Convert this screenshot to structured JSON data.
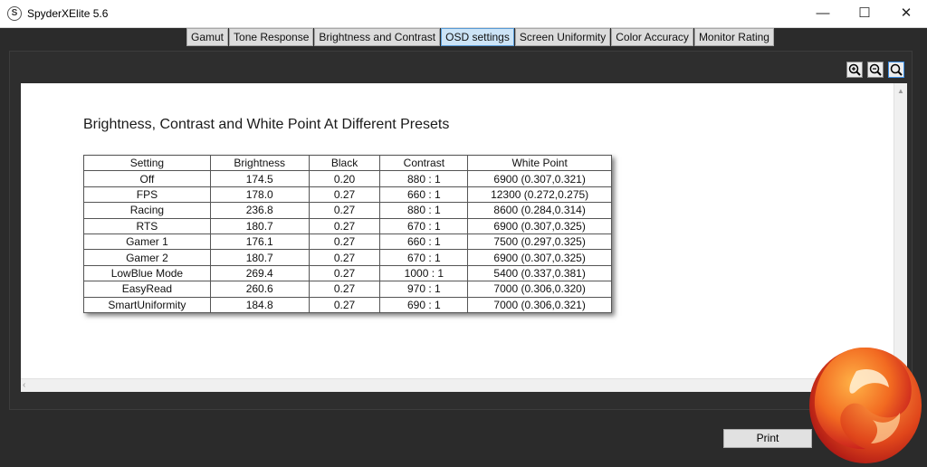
{
  "window": {
    "title": "SpyderXElite 5.6",
    "app_icon": "S"
  },
  "window_controls": {
    "minimize": "—",
    "maximize": "☐",
    "close": "✕"
  },
  "tabs": [
    "Gamut",
    "Tone Response",
    "Brightness and Contrast",
    "OSD settings",
    "Screen Uniformity",
    "Color Accuracy",
    "Monitor Rating"
  ],
  "active_tab": "OSD settings",
  "report": {
    "title": "Brightness, Contrast and White Point At Different Presets",
    "table": {
      "headers": [
        "Setting",
        "Brightness",
        "Black",
        "Contrast",
        "White Point"
      ],
      "rows": [
        [
          "Off",
          "174.5",
          "0.20",
          "880 : 1",
          "6900 (0.307,0.321)"
        ],
        [
          "FPS",
          "178.0",
          "0.27",
          "660 : 1",
          "12300 (0.272,0.275)"
        ],
        [
          "Racing",
          "236.8",
          "0.27",
          "880 : 1",
          "8600 (0.284,0.314)"
        ],
        [
          "RTS",
          "180.7",
          "0.27",
          "670 : 1",
          "6900 (0.307,0.325)"
        ],
        [
          "Gamer 1",
          "176.1",
          "0.27",
          "660 : 1",
          "7500 (0.297,0.325)"
        ],
        [
          "Gamer 2",
          "180.7",
          "0.27",
          "670 : 1",
          "6900 (0.307,0.325)"
        ],
        [
          "LowBlue Mode",
          "269.4",
          "0.27",
          "1000 : 1",
          "5400 (0.337,0.381)"
        ],
        [
          "EasyRead",
          "260.6",
          "0.27",
          "970 : 1",
          "7000 (0.306,0.320)"
        ],
        [
          "SmartUniformity",
          "184.8",
          "0.27",
          "690 : 1",
          "7000 (0.306,0.321)"
        ]
      ]
    }
  },
  "toolbar": {
    "zoom_in_icon": "zoom-in",
    "zoom_out_icon": "zoom-out",
    "zoom_fit_icon": "magnifier"
  },
  "print_label": "Print",
  "colors": {
    "active_tab_bg": "#cce4f7",
    "frame_bg": "#2b2b2b",
    "logo_orange": "#f26a21",
    "logo_red": "#c4161c"
  }
}
